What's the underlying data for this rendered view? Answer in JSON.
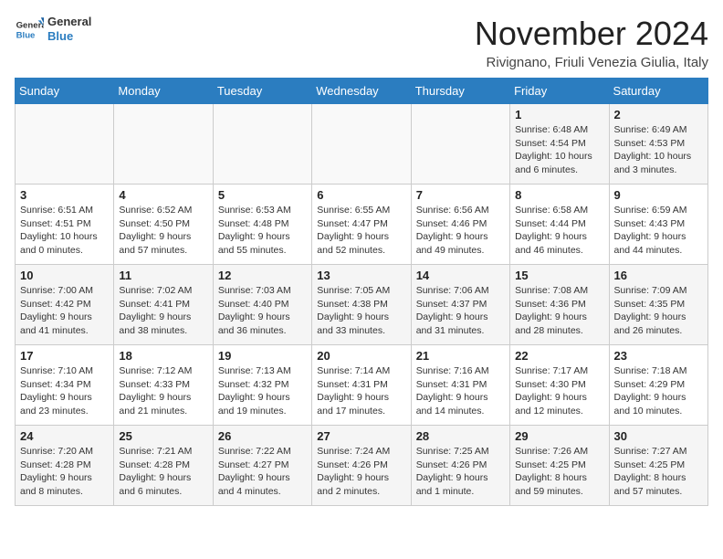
{
  "logo": {
    "general": "General",
    "blue": "Blue"
  },
  "title": "November 2024",
  "location": "Rivignano, Friuli Venezia Giulia, Italy",
  "headers": [
    "Sunday",
    "Monday",
    "Tuesday",
    "Wednesday",
    "Thursday",
    "Friday",
    "Saturday"
  ],
  "weeks": [
    [
      {
        "day": "",
        "info": ""
      },
      {
        "day": "",
        "info": ""
      },
      {
        "day": "",
        "info": ""
      },
      {
        "day": "",
        "info": ""
      },
      {
        "day": "",
        "info": ""
      },
      {
        "day": "1",
        "info": "Sunrise: 6:48 AM\nSunset: 4:54 PM\nDaylight: 10 hours and 6 minutes."
      },
      {
        "day": "2",
        "info": "Sunrise: 6:49 AM\nSunset: 4:53 PM\nDaylight: 10 hours and 3 minutes."
      }
    ],
    [
      {
        "day": "3",
        "info": "Sunrise: 6:51 AM\nSunset: 4:51 PM\nDaylight: 10 hours and 0 minutes."
      },
      {
        "day": "4",
        "info": "Sunrise: 6:52 AM\nSunset: 4:50 PM\nDaylight: 9 hours and 57 minutes."
      },
      {
        "day": "5",
        "info": "Sunrise: 6:53 AM\nSunset: 4:48 PM\nDaylight: 9 hours and 55 minutes."
      },
      {
        "day": "6",
        "info": "Sunrise: 6:55 AM\nSunset: 4:47 PM\nDaylight: 9 hours and 52 minutes."
      },
      {
        "day": "7",
        "info": "Sunrise: 6:56 AM\nSunset: 4:46 PM\nDaylight: 9 hours and 49 minutes."
      },
      {
        "day": "8",
        "info": "Sunrise: 6:58 AM\nSunset: 4:44 PM\nDaylight: 9 hours and 46 minutes."
      },
      {
        "day": "9",
        "info": "Sunrise: 6:59 AM\nSunset: 4:43 PM\nDaylight: 9 hours and 44 minutes."
      }
    ],
    [
      {
        "day": "10",
        "info": "Sunrise: 7:00 AM\nSunset: 4:42 PM\nDaylight: 9 hours and 41 minutes."
      },
      {
        "day": "11",
        "info": "Sunrise: 7:02 AM\nSunset: 4:41 PM\nDaylight: 9 hours and 38 minutes."
      },
      {
        "day": "12",
        "info": "Sunrise: 7:03 AM\nSunset: 4:40 PM\nDaylight: 9 hours and 36 minutes."
      },
      {
        "day": "13",
        "info": "Sunrise: 7:05 AM\nSunset: 4:38 PM\nDaylight: 9 hours and 33 minutes."
      },
      {
        "day": "14",
        "info": "Sunrise: 7:06 AM\nSunset: 4:37 PM\nDaylight: 9 hours and 31 minutes."
      },
      {
        "day": "15",
        "info": "Sunrise: 7:08 AM\nSunset: 4:36 PM\nDaylight: 9 hours and 28 minutes."
      },
      {
        "day": "16",
        "info": "Sunrise: 7:09 AM\nSunset: 4:35 PM\nDaylight: 9 hours and 26 minutes."
      }
    ],
    [
      {
        "day": "17",
        "info": "Sunrise: 7:10 AM\nSunset: 4:34 PM\nDaylight: 9 hours and 23 minutes."
      },
      {
        "day": "18",
        "info": "Sunrise: 7:12 AM\nSunset: 4:33 PM\nDaylight: 9 hours and 21 minutes."
      },
      {
        "day": "19",
        "info": "Sunrise: 7:13 AM\nSunset: 4:32 PM\nDaylight: 9 hours and 19 minutes."
      },
      {
        "day": "20",
        "info": "Sunrise: 7:14 AM\nSunset: 4:31 PM\nDaylight: 9 hours and 17 minutes."
      },
      {
        "day": "21",
        "info": "Sunrise: 7:16 AM\nSunset: 4:31 PM\nDaylight: 9 hours and 14 minutes."
      },
      {
        "day": "22",
        "info": "Sunrise: 7:17 AM\nSunset: 4:30 PM\nDaylight: 9 hours and 12 minutes."
      },
      {
        "day": "23",
        "info": "Sunrise: 7:18 AM\nSunset: 4:29 PM\nDaylight: 9 hours and 10 minutes."
      }
    ],
    [
      {
        "day": "24",
        "info": "Sunrise: 7:20 AM\nSunset: 4:28 PM\nDaylight: 9 hours and 8 minutes."
      },
      {
        "day": "25",
        "info": "Sunrise: 7:21 AM\nSunset: 4:28 PM\nDaylight: 9 hours and 6 minutes."
      },
      {
        "day": "26",
        "info": "Sunrise: 7:22 AM\nSunset: 4:27 PM\nDaylight: 9 hours and 4 minutes."
      },
      {
        "day": "27",
        "info": "Sunrise: 7:24 AM\nSunset: 4:26 PM\nDaylight: 9 hours and 2 minutes."
      },
      {
        "day": "28",
        "info": "Sunrise: 7:25 AM\nSunset: 4:26 PM\nDaylight: 9 hours and 1 minute."
      },
      {
        "day": "29",
        "info": "Sunrise: 7:26 AM\nSunset: 4:25 PM\nDaylight: 8 hours and 59 minutes."
      },
      {
        "day": "30",
        "info": "Sunrise: 7:27 AM\nSunset: 4:25 PM\nDaylight: 8 hours and 57 minutes."
      }
    ]
  ]
}
